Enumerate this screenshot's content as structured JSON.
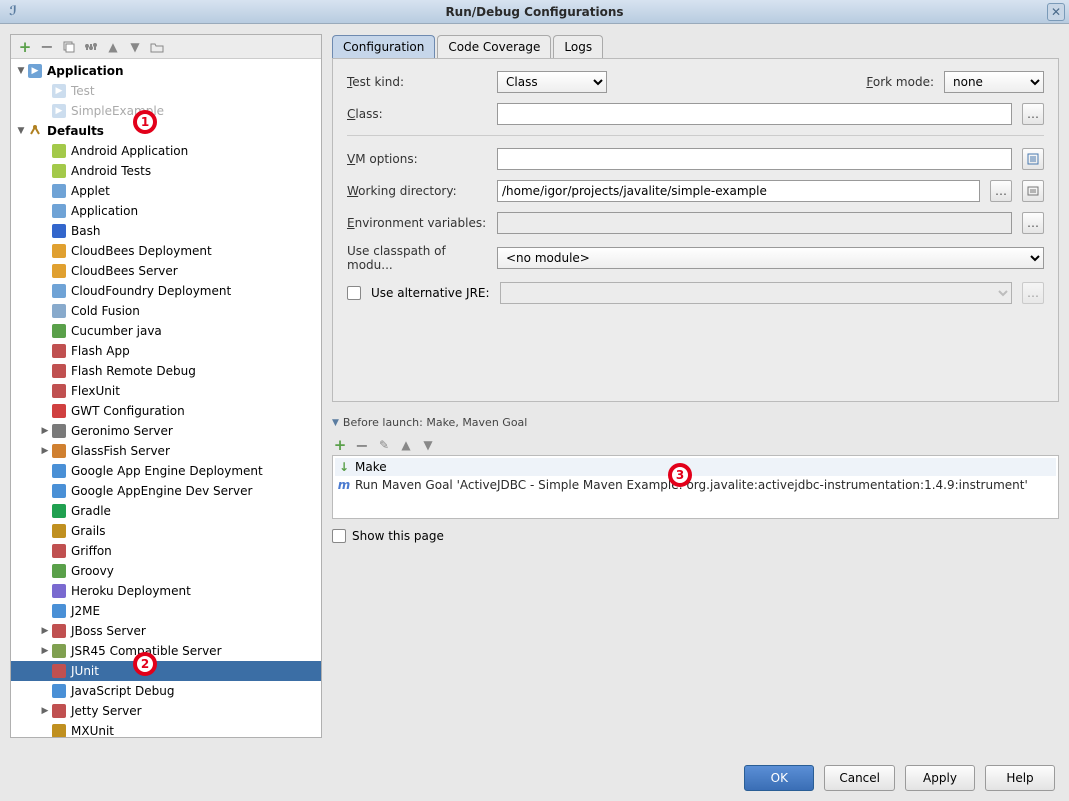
{
  "window": {
    "title": "Run/Debug Configurations"
  },
  "tree": {
    "app_group": "Application",
    "app_children": [
      "Test",
      "SimpleExample"
    ],
    "defaults_group": "Defaults",
    "items": [
      {
        "label": "Android Application",
        "color": "#a3c94a",
        "arrow": false,
        "icon": "android-icon"
      },
      {
        "label": "Android Tests",
        "color": "#a3c94a",
        "arrow": false,
        "icon": "android-icon"
      },
      {
        "label": "Applet",
        "color": "#6fa3d6",
        "arrow": false,
        "icon": "applet-icon"
      },
      {
        "label": "Application",
        "color": "#6fa3d6",
        "arrow": false,
        "icon": "application-icon"
      },
      {
        "label": "Bash",
        "color": "#3366cc",
        "arrow": false,
        "icon": "bash-icon"
      },
      {
        "label": "CloudBees Deployment",
        "color": "#e0a030",
        "arrow": false,
        "icon": "cloudbees-icon"
      },
      {
        "label": "CloudBees Server",
        "color": "#e0a030",
        "arrow": false,
        "icon": "cloudbees-icon"
      },
      {
        "label": "CloudFoundry Deployment",
        "color": "#6fa3d6",
        "arrow": false,
        "icon": "cloudfoundry-icon"
      },
      {
        "label": "Cold Fusion",
        "color": "#88aacc",
        "arrow": false,
        "icon": "coldfusion-icon"
      },
      {
        "label": "Cucumber java",
        "color": "#5aa04a",
        "arrow": false,
        "icon": "cucumber-icon"
      },
      {
        "label": "Flash App",
        "color": "#c05050",
        "arrow": false,
        "icon": "flash-icon"
      },
      {
        "label": "Flash Remote Debug",
        "color": "#c05050",
        "arrow": false,
        "icon": "flash-icon"
      },
      {
        "label": "FlexUnit",
        "color": "#c05050",
        "arrow": false,
        "icon": "flexunit-icon"
      },
      {
        "label": "GWT Configuration",
        "color": "#d04040",
        "arrow": false,
        "icon": "gwt-icon"
      },
      {
        "label": "Geronimo Server",
        "color": "#7a7a7a",
        "arrow": true,
        "icon": "geronimo-icon"
      },
      {
        "label": "GlassFish Server",
        "color": "#d08030",
        "arrow": true,
        "icon": "glassfish-icon"
      },
      {
        "label": "Google App Engine Deployment",
        "color": "#4a90d6",
        "arrow": false,
        "icon": "gae-icon"
      },
      {
        "label": "Google AppEngine Dev Server",
        "color": "#4a90d6",
        "arrow": false,
        "icon": "gae-icon"
      },
      {
        "label": "Gradle",
        "color": "#20a050",
        "arrow": false,
        "icon": "gradle-icon"
      },
      {
        "label": "Grails",
        "color": "#c09020",
        "arrow": false,
        "icon": "grails-icon"
      },
      {
        "label": "Griffon",
        "color": "#c05050",
        "arrow": false,
        "icon": "griffon-icon"
      },
      {
        "label": "Groovy",
        "color": "#5aa04a",
        "arrow": false,
        "icon": "groovy-icon"
      },
      {
        "label": "Heroku Deployment",
        "color": "#7a6ad0",
        "arrow": false,
        "icon": "heroku-icon"
      },
      {
        "label": "J2ME",
        "color": "#4a90d6",
        "arrow": false,
        "icon": "j2me-icon"
      },
      {
        "label": "JBoss Server",
        "color": "#c05050",
        "arrow": true,
        "icon": "jboss-icon"
      },
      {
        "label": "JSR45 Compatible Server",
        "color": "#80a050",
        "arrow": true,
        "icon": "jsr45-icon"
      },
      {
        "label": "JUnit",
        "color": "#c05050",
        "arrow": false,
        "selected": true,
        "icon": "junit-icon"
      },
      {
        "label": "JavaScript Debug",
        "color": "#4a90d6",
        "arrow": false,
        "icon": "jsdebug-icon"
      },
      {
        "label": "Jetty Server",
        "color": "#c05050",
        "arrow": true,
        "icon": "jetty-icon"
      },
      {
        "label": "MXUnit",
        "color": "#c09020",
        "arrow": false,
        "icon": "mxunit-icon"
      }
    ]
  },
  "tabs": {
    "t1": "Configuration",
    "t2": "Code Coverage",
    "t3": "Logs"
  },
  "form": {
    "test_kind_label": "Test kind:",
    "test_kind_value": "Class",
    "fork_mode_label": "Fork mode:",
    "fork_mode_value": "none",
    "class_label": "Class:",
    "class_value": "",
    "vm_label": "VM options:",
    "vm_value": "",
    "wd_label": "Working directory:",
    "wd_value": "/home/igor/projects/javalite/simple-example",
    "env_label": "Environment variables:",
    "env_value": "",
    "cp_label": "Use classpath of modu...",
    "cp_value": "<no module>",
    "altjre_label": "Use alternative JRE:",
    "altjre_value": ""
  },
  "before_launch": {
    "header": "Before launch: Make, Maven Goal",
    "items": [
      {
        "icon": "make-icon",
        "label": "Make"
      },
      {
        "icon": "maven-icon",
        "label": "Run Maven Goal 'ActiveJDBC - Simple Maven Example: org.javalite:activejdbc-instrumentation:1.4.9:instrument'"
      }
    ],
    "show_page": "Show this page"
  },
  "buttons": {
    "ok": "OK",
    "cancel": "Cancel",
    "apply": "Apply",
    "help": "Help"
  },
  "annotations": [
    "1",
    "2",
    "3"
  ]
}
